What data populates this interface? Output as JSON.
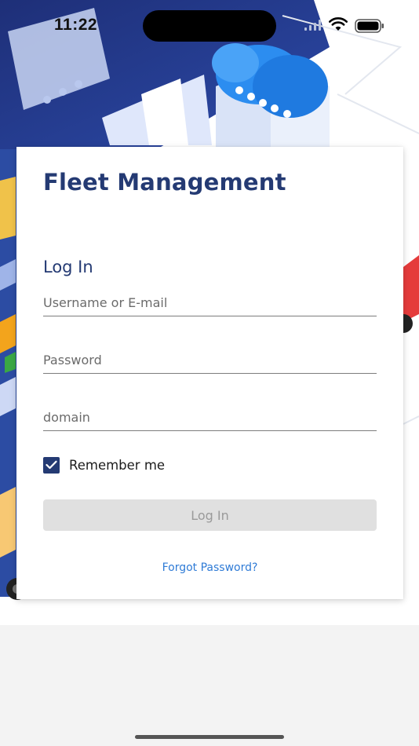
{
  "status_bar": {
    "time": "11:22"
  },
  "app": {
    "title": "Fleet Management"
  },
  "login_form": {
    "title": "Log In",
    "username": {
      "placeholder": "Username or E-mail",
      "value": ""
    },
    "password": {
      "placeholder": "Password",
      "value": ""
    },
    "domain": {
      "placeholder": "domain",
      "value": ""
    },
    "remember_me": {
      "label": "Remember me",
      "checked": true
    },
    "submit_label": "Log In",
    "submit_enabled": false,
    "forgot_password_label": "Forgot Password?"
  },
  "icons": [
    "signal-icon",
    "wifi-icon",
    "battery-icon",
    "check-icon",
    "cloud-icon"
  ],
  "colors": {
    "brand": "#243a73",
    "link": "#2f7bd6",
    "button_disabled_bg": "#e0e0e0",
    "button_disabled_text": "#9a9a9a"
  }
}
